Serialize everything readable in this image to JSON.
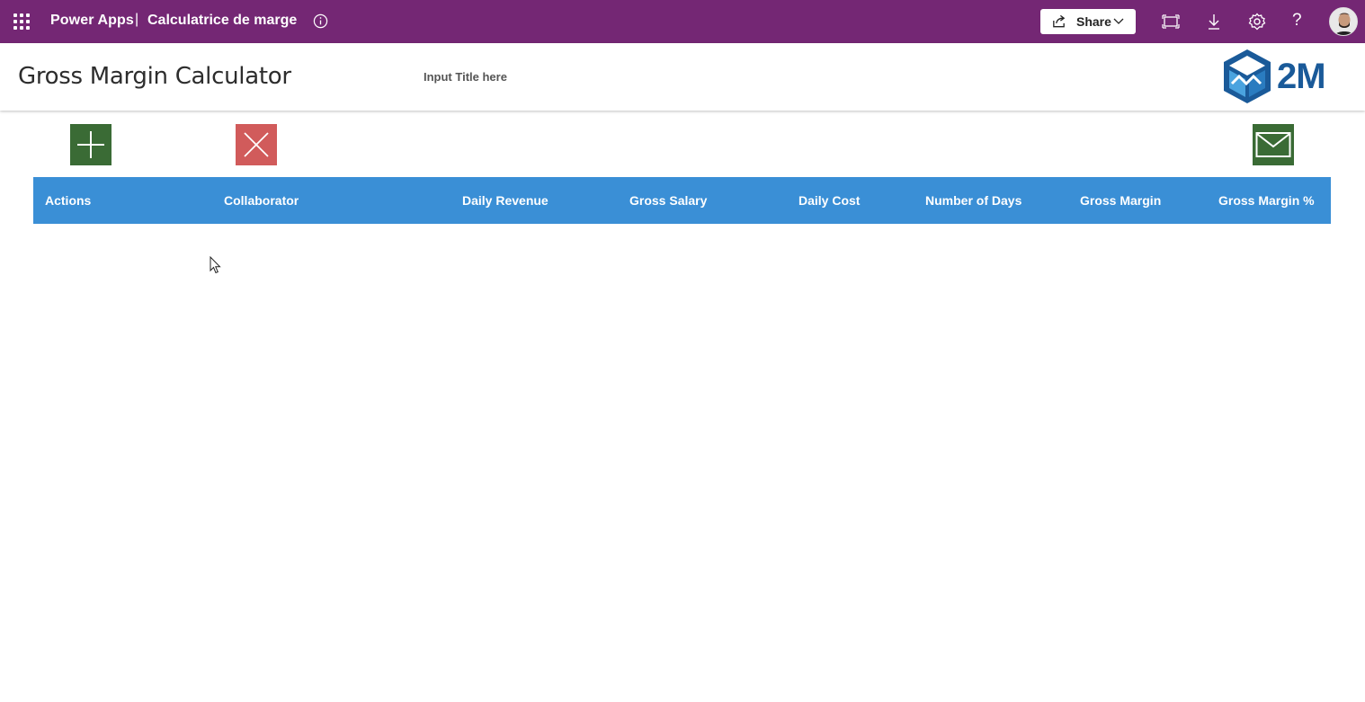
{
  "topbar": {
    "app_name": "Power Apps",
    "separator": "|",
    "app_title": "Calculatrice de marge",
    "share_label": "Share",
    "icons": [
      "waffle-icon",
      "info-icon",
      "share-icon",
      "chevron-down-icon",
      "fit-to-screen-icon",
      "download-icon",
      "settings-icon",
      "help-icon",
      "avatar"
    ],
    "help_glyph": "?",
    "color": "#742774"
  },
  "header": {
    "title": "Gross Margin Calculator",
    "input_placeholder": "Input Title here",
    "logo_text": "2M"
  },
  "actions": {
    "add_color": "#3a6b35",
    "clear_color": "#d15b5b",
    "mail_color": "#3a6b35"
  },
  "table": {
    "header_color": "#3a8fd6",
    "columns": [
      "Actions",
      "Collaborator",
      "Daily Revenue",
      "Gross Salary",
      "Daily Cost",
      "Number of Days",
      "Gross Margin",
      "Gross Margin %"
    ],
    "rows": []
  }
}
